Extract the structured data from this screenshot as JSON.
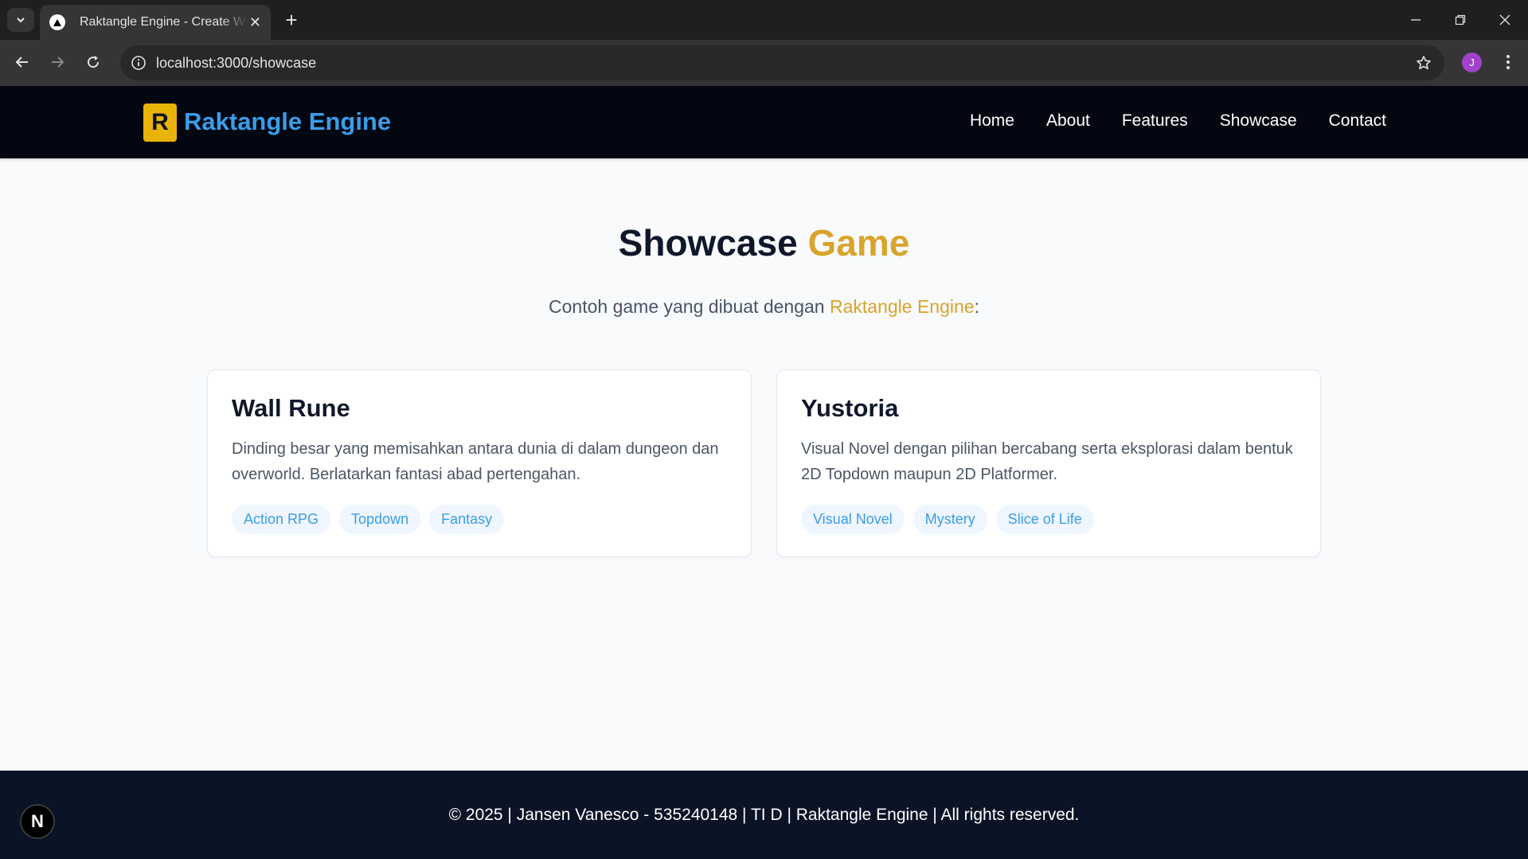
{
  "browser": {
    "tab_title": "Raktangle Engine - Create With",
    "url": "localhost:3000/showcase",
    "profile_initial": "J"
  },
  "header": {
    "logo_letter": "R",
    "brand": "Raktangle Engine",
    "nav": [
      "Home",
      "About",
      "Features",
      "Showcase",
      "Contact"
    ]
  },
  "showcase": {
    "title_main": "Showcase",
    "title_accent": "Game",
    "subtitle_prefix": "Contoh game yang dibuat dengan",
    "subtitle_accent": "Raktangle Engine",
    "subtitle_suffix": ":",
    "games": [
      {
        "title": "Wall Rune",
        "description": "Dinding besar yang memisahkan antara dunia di dalam dungeon dan overworld. Berlatarkan fantasi abad pertengahan.",
        "tags": [
          "Action RPG",
          "Topdown",
          "Fantasy"
        ]
      },
      {
        "title": "Yustoria",
        "description": "Visual Novel dengan pilihan bercabang serta eksplorasi dalam bentuk 2D Topdown maupun 2D Platformer.",
        "tags": [
          "Visual Novel",
          "Mystery",
          "Slice of Life"
        ]
      }
    ]
  },
  "footer": {
    "text": "© 2025 | Jansen Vanesco - 535240148 | TI D | Raktangle Engine | All rights reserved.",
    "badge": "N"
  },
  "colors": {
    "brand_blue": "#3b9de8",
    "accent_gold": "#d9a42a",
    "logo_yellow": "#eab308",
    "header_bg": "#030712",
    "footer_bg": "#0b1426"
  }
}
